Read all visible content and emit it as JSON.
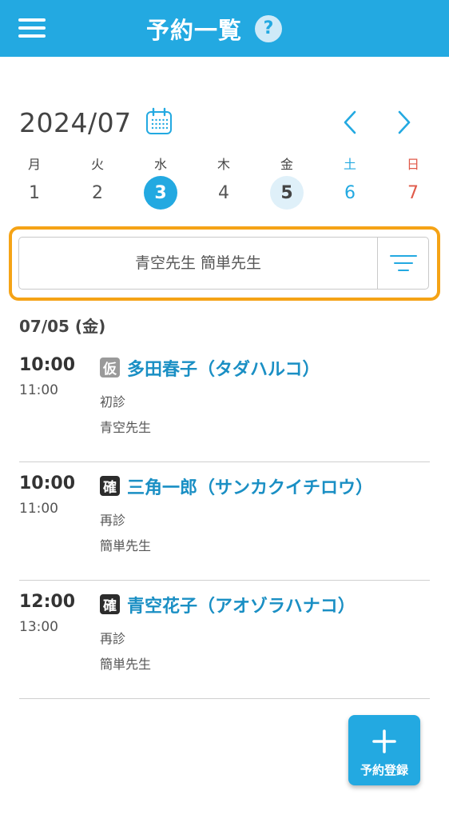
{
  "header": {
    "title": "予約一覧",
    "help_label": "?",
    "menu_icon": "hamburger-menu-icon",
    "help_icon": "question-circle-icon"
  },
  "calendar": {
    "month_label": "2024/07",
    "calendar_icon": "calendar-icon",
    "prev_icon": "chevron-left-icon",
    "next_icon": "chevron-right-icon",
    "days": [
      {
        "name": "月",
        "num": "1"
      },
      {
        "name": "火",
        "num": "2"
      },
      {
        "name": "水",
        "num": "3"
      },
      {
        "name": "木",
        "num": "4"
      },
      {
        "name": "金",
        "num": "5"
      },
      {
        "name": "土",
        "num": "6"
      },
      {
        "name": "日",
        "num": "7"
      }
    ]
  },
  "filter": {
    "value": "青空先生 簡単先生",
    "filter_icon": "filter-lines-icon"
  },
  "schedule": {
    "date_heading": "07/05 (金)",
    "appointments": [
      {
        "start": "10:00",
        "end": "11:00",
        "badge": "仮",
        "name": "多田春子（タダハルコ）",
        "type": "初診",
        "doctor": "青空先生"
      },
      {
        "start": "10:00",
        "end": "11:00",
        "badge": "確",
        "name": "三角一郎（サンカクイチロウ）",
        "type": "再診",
        "doctor": "簡単先生"
      },
      {
        "start": "12:00",
        "end": "13:00",
        "badge": "確",
        "name": "青空花子（アオゾラハナコ）",
        "type": "再診",
        "doctor": "簡単先生"
      }
    ]
  },
  "fab": {
    "label": "予約登録",
    "icon": "plus-icon"
  },
  "colors": {
    "primary": "#23a9e1",
    "highlight_outline": "#f5a316",
    "saturday": "#23a9e1",
    "sunday": "#e05a4a",
    "tentative_badge": "#9a9a9a",
    "confirmed_badge": "#2c2c2c",
    "patient_name": "#1a8fc4"
  }
}
